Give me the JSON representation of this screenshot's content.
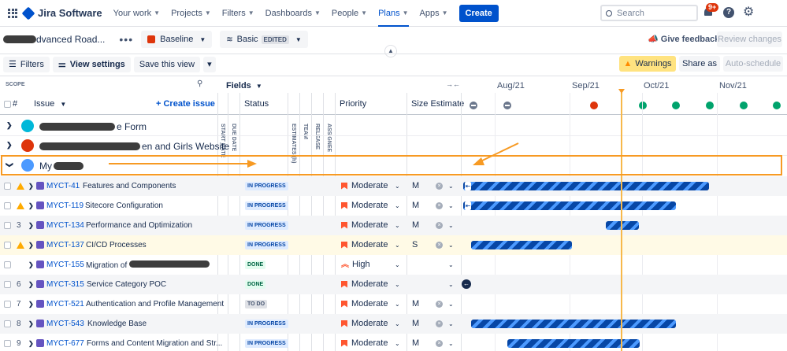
{
  "nav": {
    "app_name": "Jira Software",
    "items": [
      {
        "label": "Your work",
        "chev": true,
        "active": false
      },
      {
        "label": "Projects",
        "chev": true,
        "active": false
      },
      {
        "label": "Filters",
        "chev": true,
        "active": false
      },
      {
        "label": "Dashboards",
        "chev": true,
        "active": false
      },
      {
        "label": "People",
        "chev": true,
        "active": false
      },
      {
        "label": "Plans",
        "chev": true,
        "active": true
      },
      {
        "label": "Apps",
        "chev": true,
        "active": false
      }
    ],
    "create_label": "Create",
    "search_placeholder": "Search",
    "notification_count": "9+",
    "icons": [
      "app-switcher-icon",
      "jira-logo-icon",
      "search-icon",
      "notification-bell-icon",
      "help-icon",
      "settings-gear-icon"
    ]
  },
  "plan": {
    "title_visible": "dvanced Road...",
    "more_label": "•••",
    "scenario_label": "Baseline",
    "view_label": "Basic",
    "edited_label": "EDITED",
    "give_feedback_label": "Give feedback",
    "review_changes_label": "Review changes"
  },
  "toolbar": {
    "filters_label": "Filters",
    "view_settings_label": "View settings",
    "save_view_label": "Save this view",
    "warnings_label": "Warnings",
    "share_label": "Share as",
    "auto_schedule_label": "Auto-schedule"
  },
  "table": {
    "scope_label": "SCOPE",
    "fields_label": "Fields",
    "hash_label": "#",
    "issue_label": "Issue",
    "create_issue_label": "+ Create issue",
    "columns": {
      "status": "Status",
      "priority": "Priority",
      "size": "Size Estimate"
    },
    "vertical_columns": [
      "START DATE",
      "DUE DATE",
      "ESTIMATES (h)",
      "TEAM",
      "RELEASE",
      "ASSIGNEE"
    ],
    "months": [
      "Aug/21",
      "Sep/21",
      "Oct/21",
      "Nov/21"
    ],
    "groups": [
      {
        "label_visible": "e Form",
        "icon": "project-avatar-icon"
      },
      {
        "label_visible": "en and Girls Website",
        "icon": "project-avatar-icon"
      },
      {
        "label_visible": "My",
        "icon": "project-avatar-icon"
      }
    ],
    "rows": [
      {
        "num": "",
        "warn": true,
        "key": "MYCT-41",
        "summary": "Features and Components",
        "status": "IN PROGRESS",
        "priority": "Moderate",
        "size": "M"
      },
      {
        "num": "",
        "warn": true,
        "key": "MYCT-119",
        "summary": "Sitecore Configuration",
        "status": "IN PROGRESS",
        "priority": "Moderate",
        "size": "M"
      },
      {
        "num": "3",
        "warn": false,
        "key": "MYCT-134",
        "summary": "Performance and Optimization",
        "status": "IN PROGRESS",
        "priority": "Moderate",
        "size": "M"
      },
      {
        "num": "",
        "warn": true,
        "key": "MYCT-137",
        "summary": "CI/CD Processes",
        "status": "IN PROGRESS",
        "priority": "Moderate",
        "size": "S"
      },
      {
        "num": "",
        "warn": false,
        "key": "MYCT-155",
        "summary": "Migration of",
        "status": "DONE",
        "priority": "High",
        "size": ""
      },
      {
        "num": "6",
        "warn": false,
        "key": "MYCT-315",
        "summary": "Service Category POC",
        "status": "DONE",
        "priority": "Moderate",
        "size": ""
      },
      {
        "num": "7",
        "warn": false,
        "key": "MYCT-521",
        "summary": "Authentication and Profile Management",
        "status": "TO DO",
        "priority": "Moderate",
        "size": "M"
      },
      {
        "num": "8",
        "warn": false,
        "key": "MYCT-543",
        "summary": "Knowledge Base",
        "status": "IN PROGRESS",
        "priority": "Moderate",
        "size": "M"
      },
      {
        "num": "9",
        "warn": false,
        "key": "MYCT-677",
        "summary": "Forms and Content Migration and Str...",
        "status": "IN PROGRESS",
        "priority": "Moderate",
        "size": "M"
      }
    ]
  },
  "colors": {
    "accent": "#0052cc",
    "warning": "#ffab00",
    "highlight": "#f79a23",
    "bar_dark": "#0747a6"
  }
}
